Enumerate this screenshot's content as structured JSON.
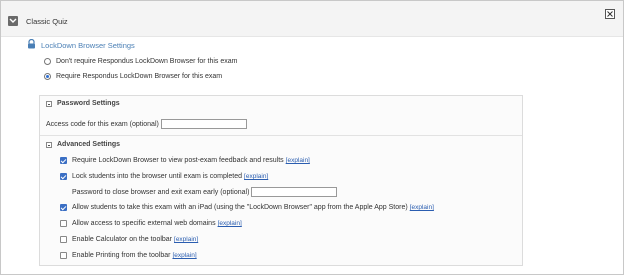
{
  "header": {
    "title": "Classic Quiz"
  },
  "section": {
    "title": "LockDown Browser Settings"
  },
  "radios": [
    {
      "label": "Don't require Respondus LockDown Browser for this exam",
      "checked": false
    },
    {
      "label": "Require Respondus LockDown Browser for this exam",
      "checked": true
    }
  ],
  "password_settings": {
    "title": "Password Settings",
    "access_code_label": "Access code for this exam (optional)",
    "access_code_value": ""
  },
  "advanced_settings": {
    "title": "Advanced Settings",
    "explain_label": "[explain]",
    "options": [
      {
        "label": "Require LockDown Browser to view post-exam feedback and results",
        "checked": true
      },
      {
        "label": "Lock students into the browser until exam is completed",
        "checked": true
      },
      {
        "label": "Allow students to take this exam with an iPad (using the \"LockDown Browser\" app from the Apple App Store)",
        "checked": true
      },
      {
        "label": "Allow access to specific external web domains",
        "checked": false
      },
      {
        "label": "Enable Calculator on the toolbar",
        "checked": false
      },
      {
        "label": "Enable Printing from the toolbar",
        "checked": false
      }
    ],
    "close_password_label": "Password to close browser and exit exam early (optional)",
    "close_password_value": ""
  }
}
